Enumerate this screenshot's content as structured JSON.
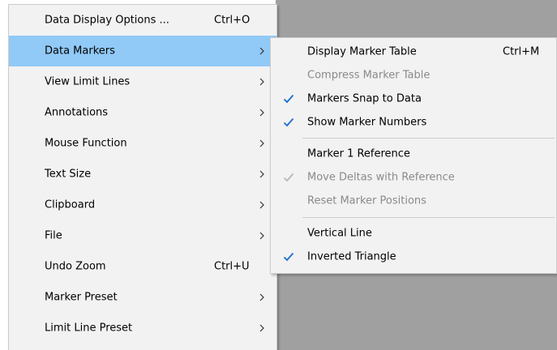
{
  "main_menu": {
    "items": [
      {
        "label": "Data Display Options ...",
        "shortcut": "Ctrl+O",
        "submenu": false,
        "highlighted": false
      },
      {
        "label": "Data Markers",
        "shortcut": "",
        "submenu": true,
        "highlighted": true
      },
      {
        "label": "View Limit Lines",
        "shortcut": "",
        "submenu": true,
        "highlighted": false
      },
      {
        "label": "Annotations",
        "shortcut": "",
        "submenu": true,
        "highlighted": false
      },
      {
        "label": "Mouse Function",
        "shortcut": "",
        "submenu": true,
        "highlighted": false
      },
      {
        "label": "Text Size",
        "shortcut": "",
        "submenu": true,
        "highlighted": false
      },
      {
        "label": "Clipboard",
        "shortcut": "",
        "submenu": true,
        "highlighted": false
      },
      {
        "label": "File",
        "shortcut": "",
        "submenu": true,
        "highlighted": false
      },
      {
        "label": "Undo Zoom",
        "shortcut": "Ctrl+U",
        "submenu": false,
        "highlighted": false
      },
      {
        "label": "Marker Preset",
        "shortcut": "",
        "submenu": true,
        "highlighted": false
      },
      {
        "label": "Limit Line Preset",
        "shortcut": "",
        "submenu": true,
        "highlighted": false
      }
    ]
  },
  "sub_menu": {
    "items": [
      {
        "label": "Display Marker Table",
        "shortcut": "Ctrl+M",
        "checked": false,
        "disabled": false
      },
      {
        "label": "Compress Marker Table",
        "shortcut": "",
        "checked": false,
        "disabled": true
      },
      {
        "label": "Markers Snap to Data",
        "shortcut": "",
        "checked": true,
        "disabled": false
      },
      {
        "label": "Show Marker Numbers",
        "shortcut": "",
        "checked": true,
        "disabled": false
      },
      {
        "label": "Marker 1 Reference",
        "shortcut": "",
        "checked": false,
        "disabled": false
      },
      {
        "label": "Move Deltas with Reference",
        "shortcut": "",
        "checked": true,
        "disabled": true
      },
      {
        "label": "Reset Marker Positions",
        "shortcut": "",
        "checked": false,
        "disabled": true
      },
      {
        "label": "Vertical Line",
        "shortcut": "",
        "checked": false,
        "disabled": false
      },
      {
        "label": "Inverted Triangle",
        "shortcut": "",
        "checked": true,
        "disabled": false
      }
    ]
  },
  "colors": {
    "highlight": "#91c9f7",
    "check": "#1d6fd1",
    "check_disabled": "#b8b8b8",
    "disabled_text": "#8a8a8a",
    "menu_bg": "#f2f2f2",
    "background_gray": "#a0a0a0"
  },
  "icons": {
    "submenu_arrow": "chevron-right-icon",
    "check": "checkmark-icon"
  }
}
